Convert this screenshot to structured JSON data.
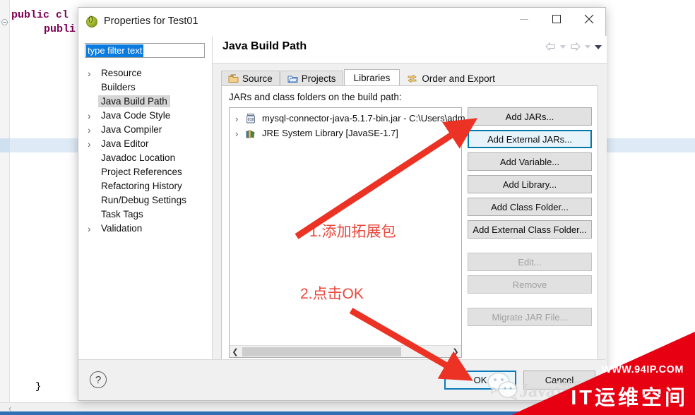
{
  "background_ide": {
    "code_line_1": "public cl",
    "code_line_2": "publi",
    "closing_brace": "}",
    "fold_icon": "code-fold-icon"
  },
  "dialog": {
    "title": "Properties for Test01",
    "title_icon": "eclipse-properties-icon",
    "window_controls": {
      "minimize": "minimize-icon",
      "maximize": "maximize-icon",
      "close": "close-icon"
    },
    "header": {
      "title": "Java Build Path",
      "nav": {
        "back": "back-arrow-icon",
        "back_menu": "chevron-down-icon",
        "forward": "forward-arrow-icon",
        "forward_menu": "chevron-down-icon",
        "more": "chevron-down-filled-icon"
      }
    },
    "filter": {
      "value": "type filter text",
      "placeholder": "type filter text"
    },
    "tree": [
      {
        "label": "Resource",
        "expandable": true,
        "selected": false
      },
      {
        "label": "Builders",
        "expandable": false,
        "selected": false
      },
      {
        "label": "Java Build Path",
        "expandable": false,
        "selected": true
      },
      {
        "label": "Java Code Style",
        "expandable": true,
        "selected": false
      },
      {
        "label": "Java Compiler",
        "expandable": true,
        "selected": false
      },
      {
        "label": "Java Editor",
        "expandable": true,
        "selected": false
      },
      {
        "label": "Javadoc Location",
        "expandable": false,
        "selected": false
      },
      {
        "label": "Project References",
        "expandable": false,
        "selected": false
      },
      {
        "label": "Refactoring History",
        "expandable": false,
        "selected": false
      },
      {
        "label": "Run/Debug Settings",
        "expandable": false,
        "selected": false
      },
      {
        "label": "Task Tags",
        "expandable": false,
        "selected": false
      },
      {
        "label": "Validation",
        "expandable": true,
        "selected": false
      }
    ],
    "tabs": [
      {
        "label": "Source",
        "icon": "source-folder-icon",
        "active": false
      },
      {
        "label": "Projects",
        "icon": "projects-folder-icon",
        "active": false
      },
      {
        "label": "Libraries",
        "icon": "",
        "active": true
      },
      {
        "label": "Order and Export",
        "icon": "order-export-icon",
        "active": false
      }
    ],
    "pane": {
      "label": "JARs and class folders on the build path:",
      "entries": [
        {
          "name": "mysql-connector-java-5.1.7-bin.jar - C:\\Users\\adm",
          "icon": "jar-file-icon"
        },
        {
          "name": "JRE System Library [JavaSE-1.7]",
          "icon": "jre-library-icon"
        }
      ],
      "scrollbar": {
        "left_arrow": "chevron-left-icon",
        "right_arrow": "chevron-right-icon"
      }
    },
    "buttons": [
      {
        "label": "Add JARs...",
        "state": "normal"
      },
      {
        "label": "Add External JARs...",
        "state": "focused"
      },
      {
        "label": "Add Variable...",
        "state": "normal"
      },
      {
        "label": "Add Library...",
        "state": "normal"
      },
      {
        "label": "Add Class Folder...",
        "state": "normal"
      },
      {
        "label": "Add External Class Folder...",
        "state": "normal"
      },
      {
        "label": "Edit...",
        "state": "disabled"
      },
      {
        "label": "Remove",
        "state": "disabled"
      },
      {
        "label": "Migrate JAR File...",
        "state": "disabled"
      }
    ],
    "footer": {
      "help": "?",
      "ok": "OK",
      "cancel": "Cancel"
    }
  },
  "annotations": {
    "step1": "1.添加拓展包",
    "step2": "2.点击OK",
    "color": "#e8493c"
  },
  "watermark": {
    "wechat_icon": "wechat-icon",
    "wechat_text": "Java进阶",
    "url": "WWW.94IP.COM",
    "site_name": "IT运维空间",
    "banner_color": "#e60012"
  }
}
